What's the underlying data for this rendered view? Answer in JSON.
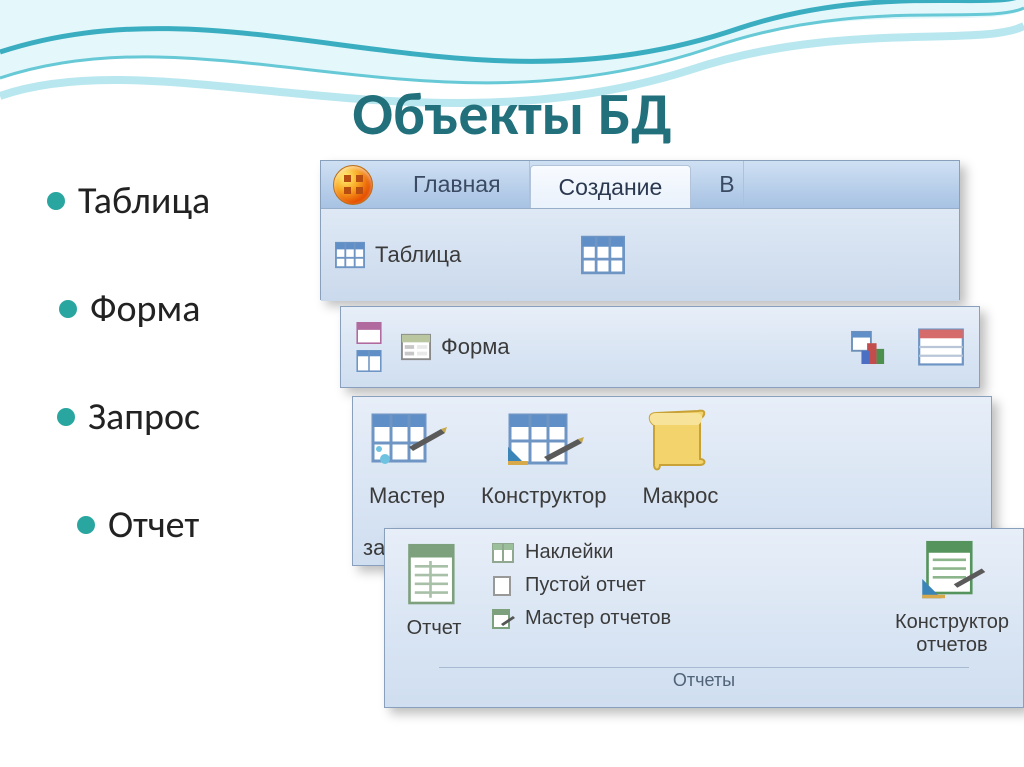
{
  "title": "Объекты БД",
  "bullets": [
    "Таблица",
    "Форма",
    "Запрос",
    "Отчет"
  ],
  "ribbon": {
    "tabs": {
      "home": "Главная",
      "create": "Создание",
      "cut": "В"
    },
    "table_btn": "Таблица",
    "form_btn": "Форма",
    "wizard": "Мастер",
    "wizard_trunc": "за",
    "designer": "Конструктор",
    "macro": "Макрос",
    "report": "Отчет",
    "labels": "Наклейки",
    "blank_report": "Пустой отчет",
    "report_wizard": "Мастер отчетов",
    "report_designer": "Конструктор\nотчетов",
    "group_reports": "Отчеты"
  }
}
